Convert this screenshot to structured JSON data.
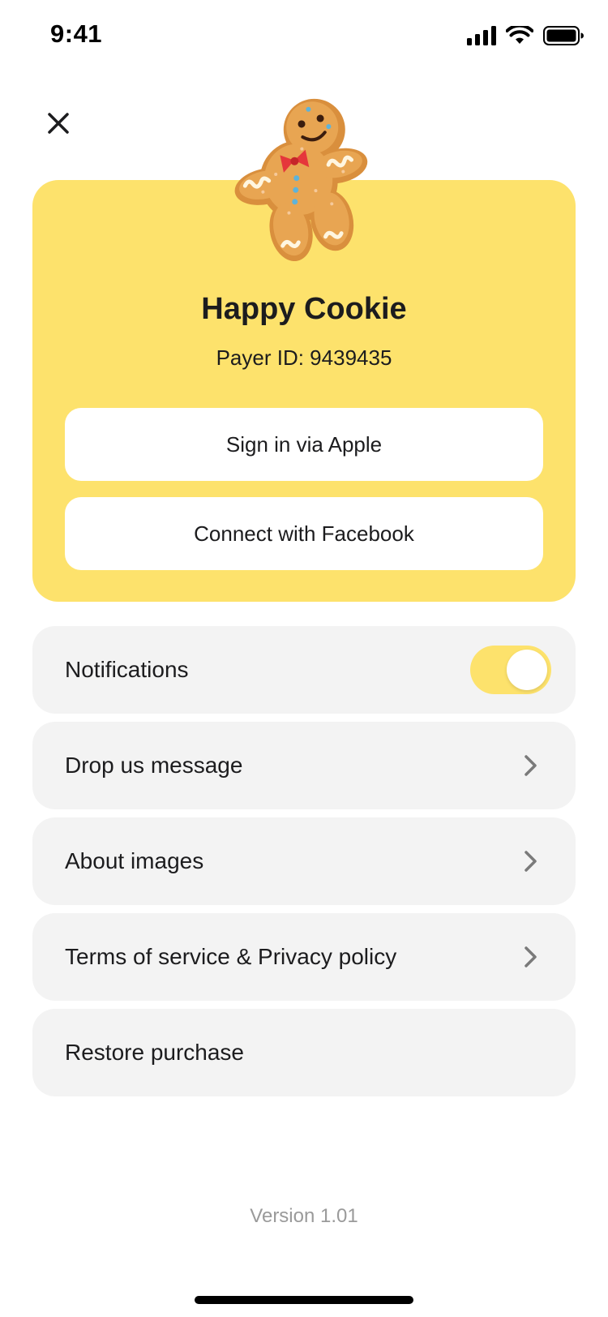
{
  "status_bar": {
    "time": "9:41",
    "icons": [
      "cellular-signal-icon",
      "wifi-icon",
      "battery-icon"
    ]
  },
  "header": {
    "close_icon": "close-icon"
  },
  "profile": {
    "avatar_icon": "gingerbread-cookie-avatar",
    "name": "Happy Cookie",
    "payer_id": "Payer ID: 9439435",
    "sign_in_apple_label": "Sign in via Apple",
    "connect_facebook_label": "Connect with Facebook"
  },
  "settings": {
    "notifications": {
      "label": "Notifications",
      "enabled": true
    },
    "items": [
      {
        "label": "Drop us message",
        "icon": "chevron-right-icon"
      },
      {
        "label": "About images",
        "icon": "chevron-right-icon"
      },
      {
        "label": "Terms of service & Privacy policy",
        "icon": "chevron-right-icon"
      },
      {
        "label": "Restore purchase"
      }
    ]
  },
  "footer": {
    "version": "Version 1.01"
  },
  "colors": {
    "accent": "#fde26c",
    "row_background": "#f3f3f3",
    "text": "#1c1c1e",
    "muted": "#9a9a9a"
  }
}
